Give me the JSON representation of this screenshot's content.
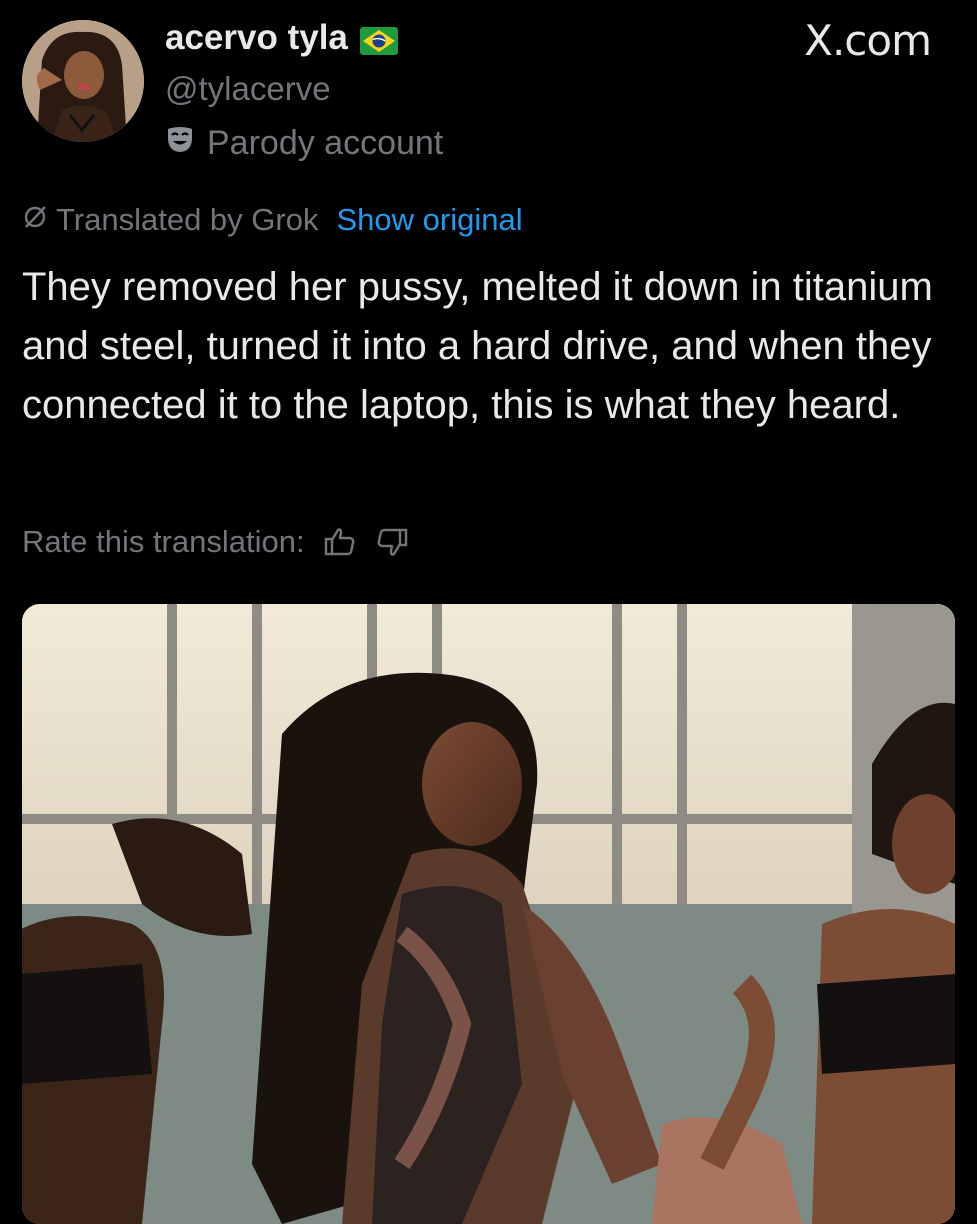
{
  "tweet": {
    "display_name": "acervo tyla",
    "flag_icon": "brazil-flag-icon",
    "handle": "@tylacerve",
    "badge_icon": "parody-mask-icon",
    "badge_label": "Parody account",
    "source_logo": "X.com",
    "translation": {
      "icon": "grok-icon",
      "label": "Translated by Grok",
      "show_original": "Show original"
    },
    "text": "They removed her pussy, melted it down in titanium and steel, turned it into a hard drive, and when they connected it to the laptop, this is what they heard.",
    "rate": {
      "label": "Rate this translation:",
      "thumbs_up_icon": "thumbs-up-icon",
      "thumbs_down_icon": "thumbs-down-icon"
    },
    "media": {
      "type": "video-frame",
      "description_icon": "media-thumbnail"
    }
  },
  "colors": {
    "background": "#000000",
    "text_primary": "#e7e9ea",
    "text_secondary": "#71767b",
    "link": "#1d9bf0"
  }
}
